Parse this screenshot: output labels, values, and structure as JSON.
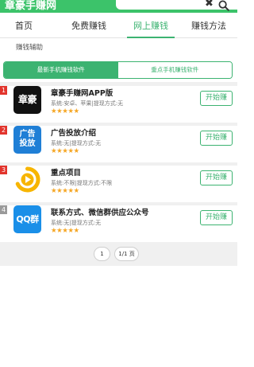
{
  "header": {
    "logo_text": "章豪手赚网",
    "search_value": "",
    "clear_icon_glyph": "✖",
    "search_icon": "search-icon",
    "colors": {
      "brand_green": "#3cc36a",
      "accent": "#3cb371",
      "rank_red": "#e2342c",
      "star": "#f5a623"
    }
  },
  "nav": {
    "items": [
      {
        "label": "首页"
      },
      {
        "label": "免费赚钱"
      },
      {
        "label": "网上赚钱"
      },
      {
        "label": "赚钱方法"
      }
    ],
    "active_index": 2
  },
  "section": {
    "label": "赚钱辅助"
  },
  "tabs": {
    "items": [
      {
        "label": "最新手机赚钱软件"
      },
      {
        "label": "重点手机赚钱软件"
      }
    ],
    "active_index": 0
  },
  "apps": [
    {
      "rank": "1",
      "icon_text": "章豪",
      "icon_name": "zhanghao-app-icon",
      "title": "章豪手赚网APP版",
      "meta": "系统:安卓、苹果|提现方式:无",
      "stars": "★★★★★",
      "button": "开始赚"
    },
    {
      "rank": "2",
      "icon_text": "广告投放",
      "icon_name": "ad-app-icon",
      "title": "广告投放介绍",
      "meta": "系统:无|提现方式:无",
      "stars": "★★★★★",
      "button": "开始赚"
    },
    {
      "rank": "3",
      "icon_text": "",
      "icon_name": "key-project-icon",
      "title": "重点项目",
      "meta": "系统:不限|提现方式:不限",
      "stars": "★★★★★",
      "button": "开始赚"
    },
    {
      "rank": "4",
      "icon_text": "QQ群",
      "icon_name": "qq-group-icon",
      "title": "联系方式、微信群供应公众号",
      "meta": "系统:无|提现方式:无",
      "stars": "★★★★★",
      "button": "开始赚"
    }
  ],
  "pager": {
    "current": "1",
    "total": "1/1 页"
  }
}
